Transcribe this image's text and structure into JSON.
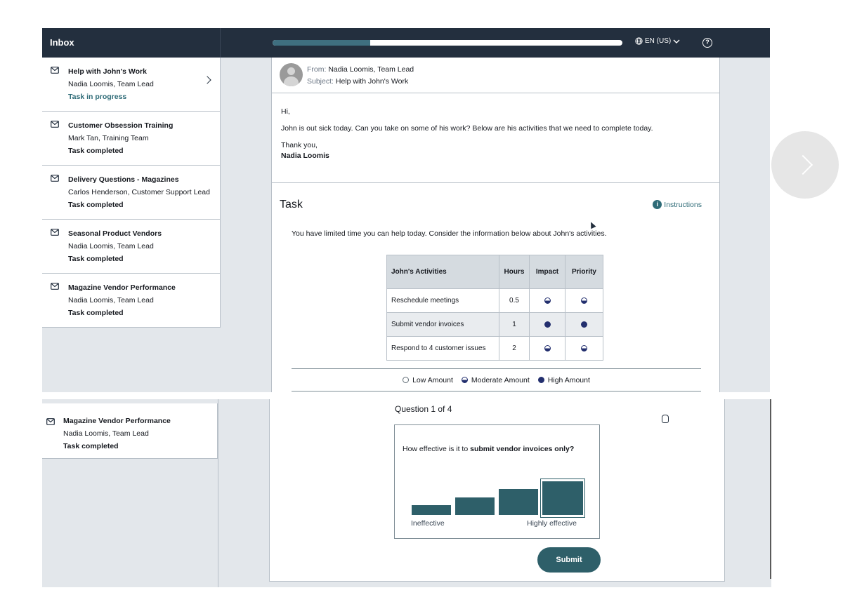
{
  "header": {
    "inbox_title": "Inbox",
    "progress_percent": 28,
    "language": "EN (US)",
    "help_glyph": "?"
  },
  "mail_items": [
    {
      "title": "Help with John's Work",
      "from": "Nadia Loomis, Team Lead",
      "status": "Task in progress"
    },
    {
      "title": "Customer Obsession Training",
      "from": "Mark Tan, Training Team",
      "status": "Task completed"
    },
    {
      "title": "Delivery Questions - Magazines",
      "from": "Carlos Henderson, Customer Support Lead",
      "status": "Task completed"
    },
    {
      "title": "Seasonal Product Vendors",
      "from": "Nadia Loomis, Team Lead",
      "status": "Task completed"
    },
    {
      "title": "Magazine Vendor Performance",
      "from": "Nadia Loomis, Team Lead",
      "status": "Task completed"
    }
  ],
  "email": {
    "from_label": "From:",
    "from_value": "Nadia Loomis, Team Lead",
    "subject_label": "Subject:",
    "subject_value": "Help with John's Work",
    "greeting": "Hi,",
    "body": "John is out sick today. Can you take on some of his work? Below are his activities that we need to complete today.",
    "closing": "Thank you,",
    "signature": "Nadia Loomis"
  },
  "task": {
    "title": "Task",
    "instructions_label": "Instructions",
    "info_glyph": "i",
    "description": "You have limited time you can help today. Consider the information below about John's activities.",
    "table": {
      "headers": [
        "John's Activities",
        "Hours",
        "Impact",
        "Priority"
      ],
      "rows": [
        {
          "activity": "Reschedule meetings",
          "hours": "0.5",
          "impact": "moderate",
          "priority": "moderate"
        },
        {
          "activity": "Submit vendor invoices",
          "hours": "1",
          "impact": "high",
          "priority": "high"
        },
        {
          "activity": "Respond to 4 customer issues",
          "hours": "2",
          "impact": "moderate",
          "priority": "moderate"
        }
      ]
    },
    "legend": {
      "low": "Low Amount",
      "moderate": "Moderate Amount",
      "high": "High Amount"
    }
  },
  "question": {
    "counter": "Question 1 of 4",
    "text_prefix": "How effective is it to ",
    "text_bold": "submit vendor invoices only?",
    "scale_low": "Ineffective",
    "scale_high": "Highly effective",
    "options_count": 4,
    "selected_index": 3,
    "submit_label": "Submit"
  },
  "colors": {
    "topbar": "#232f3e",
    "accent_teal": "#2e5f69",
    "level_navy": "#232f6e"
  }
}
